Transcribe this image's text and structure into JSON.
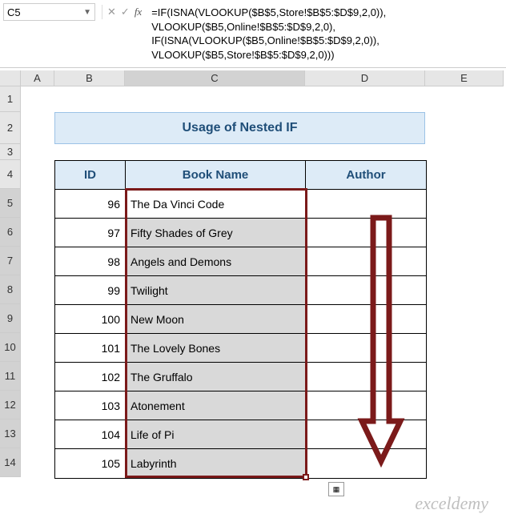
{
  "name_box": "C5",
  "fx_label": "fx",
  "formula": "=IF(ISNA(VLOOKUP($B$5,Store!$B$5:$D$9,2,0)),\nVLOOKUP($B5,Online!$B$5:$D$9,2,0),\nIF(ISNA(VLOOKUP($B5,Online!$B$5:$D$9,2,0)),\nVLOOKUP($B5,Store!$B$5:$D$9,2,0)))",
  "columns": [
    "A",
    "B",
    "C",
    "D",
    "E"
  ],
  "rows": [
    "1",
    "2",
    "3",
    "4",
    "5",
    "6",
    "7",
    "8",
    "9",
    "10",
    "11",
    "12",
    "13",
    "14"
  ],
  "title": "Usage of Nested IF",
  "headers": {
    "id": "ID",
    "book": "Book Name",
    "author": "Author"
  },
  "data": [
    {
      "id": "96",
      "book": "The Da Vinci Code",
      "author": ""
    },
    {
      "id": "97",
      "book": "Fifty Shades of Grey",
      "author": ""
    },
    {
      "id": "98",
      "book": "Angels and Demons",
      "author": ""
    },
    {
      "id": "99",
      "book": "Twilight",
      "author": ""
    },
    {
      "id": "100",
      "book": "New Moon",
      "author": ""
    },
    {
      "id": "101",
      "book": "The Lovely Bones",
      "author": ""
    },
    {
      "id": "102",
      "book": "The Gruffalo",
      "author": ""
    },
    {
      "id": "103",
      "book": "Atonement",
      "author": ""
    },
    {
      "id": "104",
      "book": "Life of Pi",
      "author": ""
    },
    {
      "id": "105",
      "book": "Labyrinth",
      "author": ""
    }
  ],
  "watermark": "exceldemy",
  "chart_data": {
    "type": "table",
    "title": "Usage of Nested IF",
    "columns": [
      "ID",
      "Book Name",
      "Author"
    ],
    "rows": [
      [
        96,
        "The Da Vinci Code",
        ""
      ],
      [
        97,
        "Fifty Shades of Grey",
        ""
      ],
      [
        98,
        "Angels and Demons",
        ""
      ],
      [
        99,
        "Twilight",
        ""
      ],
      [
        100,
        "New Moon",
        ""
      ],
      [
        101,
        "The Lovely Bones",
        ""
      ],
      [
        102,
        "The Gruffalo",
        ""
      ],
      [
        103,
        "Atonement",
        ""
      ],
      [
        104,
        "Life of Pi",
        ""
      ],
      [
        105,
        "Labyrinth",
        ""
      ]
    ]
  }
}
